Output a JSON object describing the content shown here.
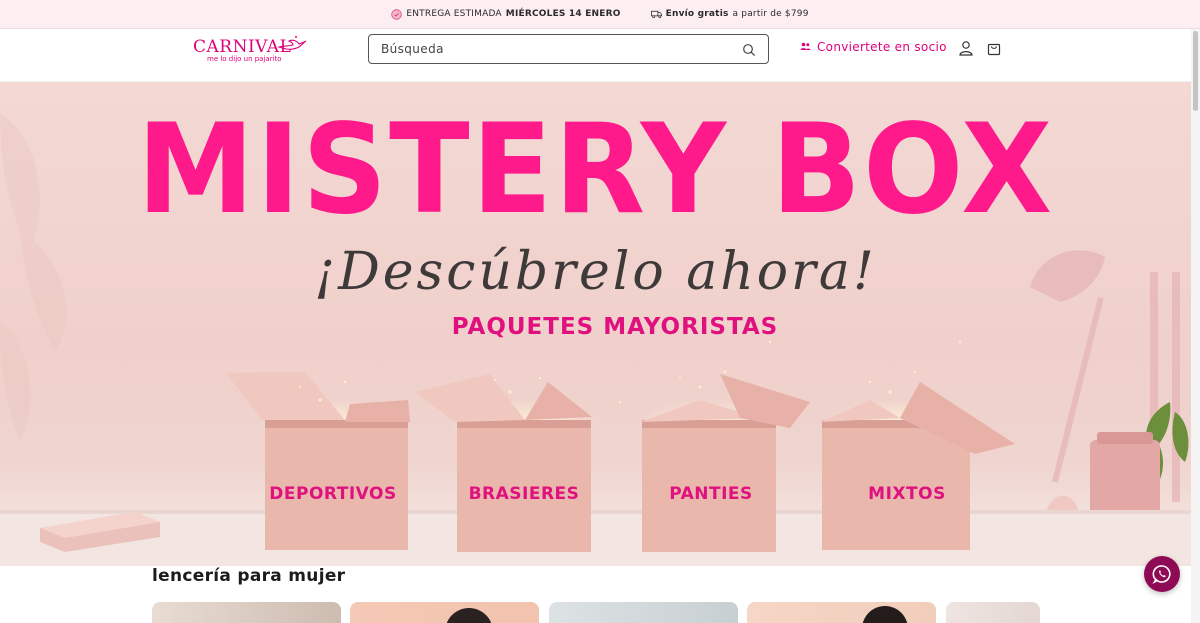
{
  "announcement": {
    "delivery_prefix": "ENTREGA ESTIMADA",
    "delivery_date": "MIÉRCOLES 14 ENERO",
    "shipping_bold": "Envío gratis",
    "shipping_rest": "a partir de $799"
  },
  "header": {
    "logo_brand": "CARNIVAL",
    "logo_tagline": "me lo dijo un pajarito",
    "search_placeholder": "Búsqueda",
    "partner_label": "Conviertete en socio"
  },
  "hero": {
    "title": "MISTERY BOX",
    "script": "¡Descúbrelo ahora!",
    "subtitle": "PAQUETES MAYORISTAS",
    "boxes": [
      "DEPORTIVOS",
      "BRASIERES",
      "PANTIES",
      "MIXTOS"
    ]
  },
  "section": {
    "title": "lencería para mujer"
  },
  "colors": {
    "brand_pink": "#e0007a",
    "hero_pink": "#ff1a8c",
    "chat_bg": "#8e0a55"
  },
  "icons": {
    "delivery": "clock-icon",
    "shipping": "truck-icon",
    "search": "search-icon",
    "partner": "users-icon",
    "account": "user-icon",
    "cart": "bag-icon",
    "chat": "whatsapp-icon"
  }
}
